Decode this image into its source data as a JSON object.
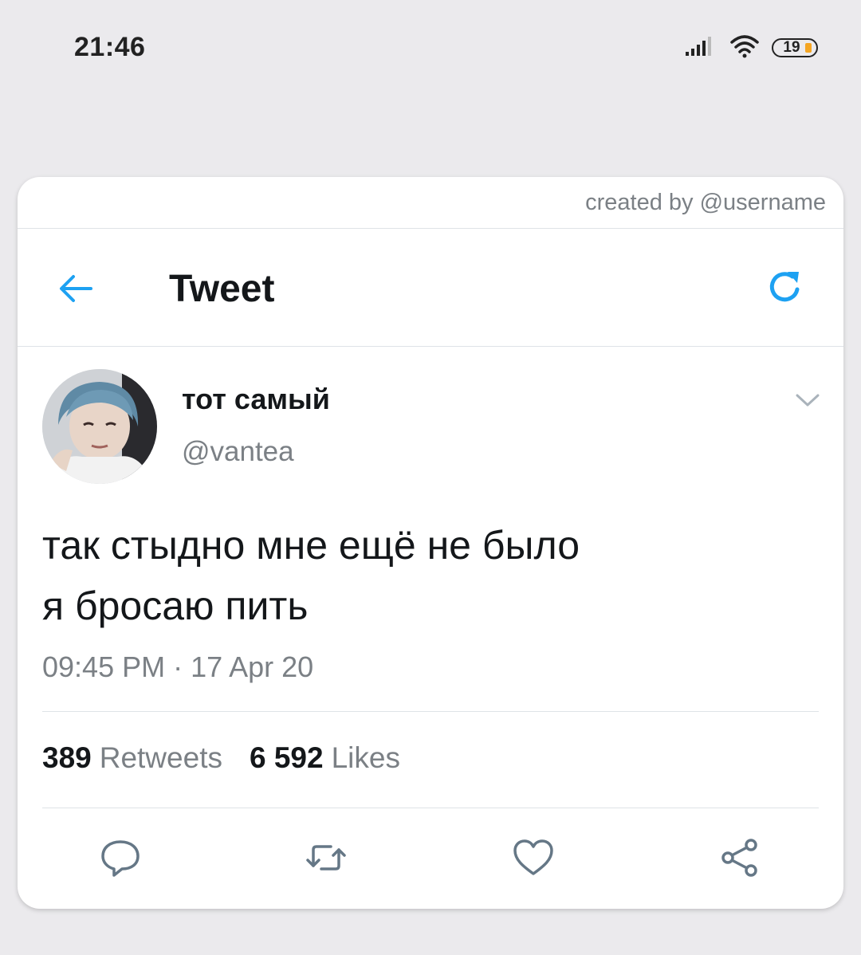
{
  "status_bar": {
    "time": "21:46",
    "battery": "19",
    "signal_icon": "cellular-signal-icon",
    "wifi_icon": "wifi-icon",
    "battery_icon": "battery-icon"
  },
  "credit": "created by @username",
  "header": {
    "title": "Tweet",
    "back_icon": "arrow-left-icon",
    "refresh_icon": "refresh-icon"
  },
  "tweet": {
    "display_name": "тот самый",
    "handle": "@vantea",
    "lines": [
      "так стыдно мне ещё не было",
      "я бросаю пить"
    ],
    "timestamp": "09:45 PM · 17 Apr 20",
    "retweets_count": "389",
    "retweets_label": "Retweets",
    "likes_count": "6 592",
    "likes_label": "Likes"
  },
  "actions": [
    "reply-icon",
    "retweet-icon",
    "like-icon",
    "share-icon"
  ],
  "colors": {
    "accent": "#1da1f2",
    "secondary_text": "#7b8085",
    "background": "#ebeaed"
  }
}
